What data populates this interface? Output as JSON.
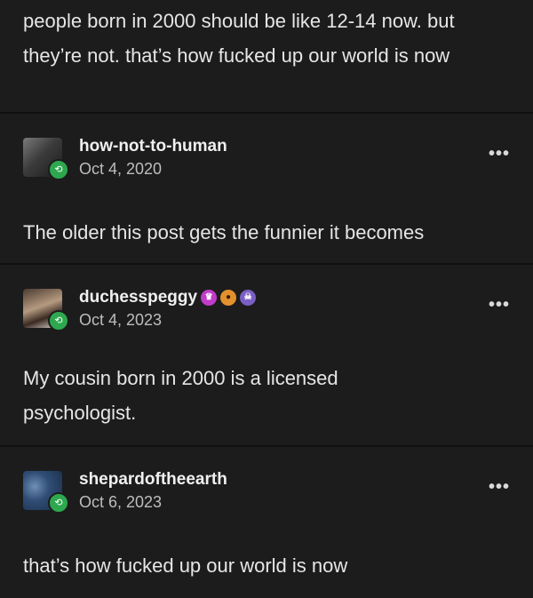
{
  "top_post": {
    "text": "people born in 2000 should be like 12-14 now. but they’re not. that’s how fucked up our world is now"
  },
  "reblogs": [
    {
      "username": "how-not-to-human",
      "date": "Oct 4, 2020",
      "text": "The older this post gets the funnier it becomes",
      "more": "•••"
    },
    {
      "username": "duchesspeggy",
      "date": "Oct 4, 2023",
      "text": "My cousin born in 2000 is a licensed psychologist.",
      "more": "•••",
      "badges": [
        "crown-badge-icon",
        "paw-badge-icon",
        "skull-badge-icon"
      ]
    },
    {
      "username": "shepardoftheearth",
      "date": "Oct 6, 2023",
      "text": "that’s how fucked up our world is now",
      "more": "•••"
    }
  ],
  "colors": {
    "background": "#1c1c1c",
    "reblog_badge": "#2ea84f"
  }
}
